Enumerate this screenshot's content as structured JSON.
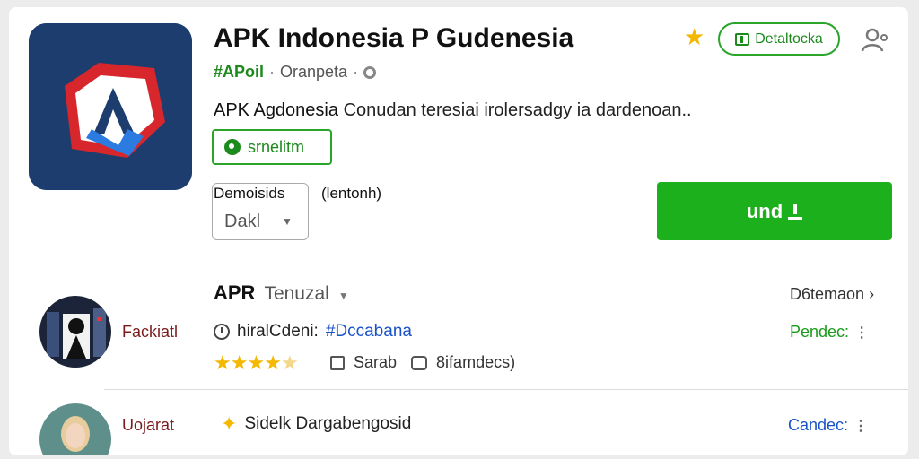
{
  "app": {
    "title": "APK Indonesia P Gudenesia",
    "tag": "#APoil",
    "tag_suffix": "·",
    "developer": "Oranpeta",
    "description_bold": "APK Agdonesia",
    "description_rest": "Conudan teresiai irolersadgy ia dardenoan..",
    "chip_label": "srnelitm",
    "selector_label": "Demoisids",
    "selector_value": "Dakl",
    "selector_note": "(lentonh)",
    "install_label": "und"
  },
  "header": {
    "pill_label": "Detaltocka",
    "star_icon": "star-icon",
    "user_icon": "user-icon"
  },
  "reviews": {
    "heading": "APR",
    "sort_label": "Tenuzal",
    "see_more": "D6temaon",
    "items": [
      {
        "name": "Fackiatl",
        "line": "hiralCdeni:",
        "hashtag": "#Dccabana",
        "status": "Pendec:",
        "rating": 4.5,
        "like_label": "Sarab",
        "reply_label": "8ifamdecs)"
      },
      {
        "name": "Uojarat",
        "line": "Sidelk Dargabengosid",
        "status": "Candec:"
      }
    ]
  },
  "colors": {
    "accent_green": "#1db01d",
    "icon_bg": "#1d3d6e",
    "star": "#f5b800",
    "link_blue": "#1a52c8"
  }
}
